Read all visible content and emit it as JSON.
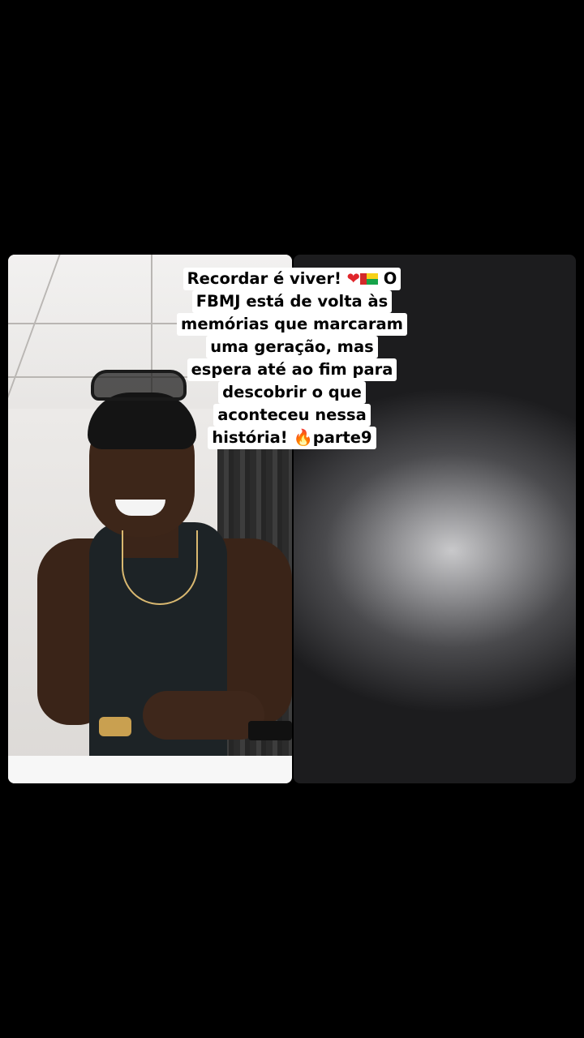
{
  "caption": {
    "lines": [
      "Recordar é viver!",
      "O",
      "FBMJ está de volta às",
      "memórias que marcaram",
      "uma geração, mas",
      "espera até ao fim para",
      "descobrir o que",
      "aconteceu nessa",
      "história!",
      "parte9"
    ],
    "icons": [
      "heart-icon",
      "guinea-bissau-flag-icon",
      "fire-icon"
    ]
  },
  "colors": {
    "background": "#000000",
    "caption_bg": "#ffffff",
    "caption_text": "#000000"
  }
}
